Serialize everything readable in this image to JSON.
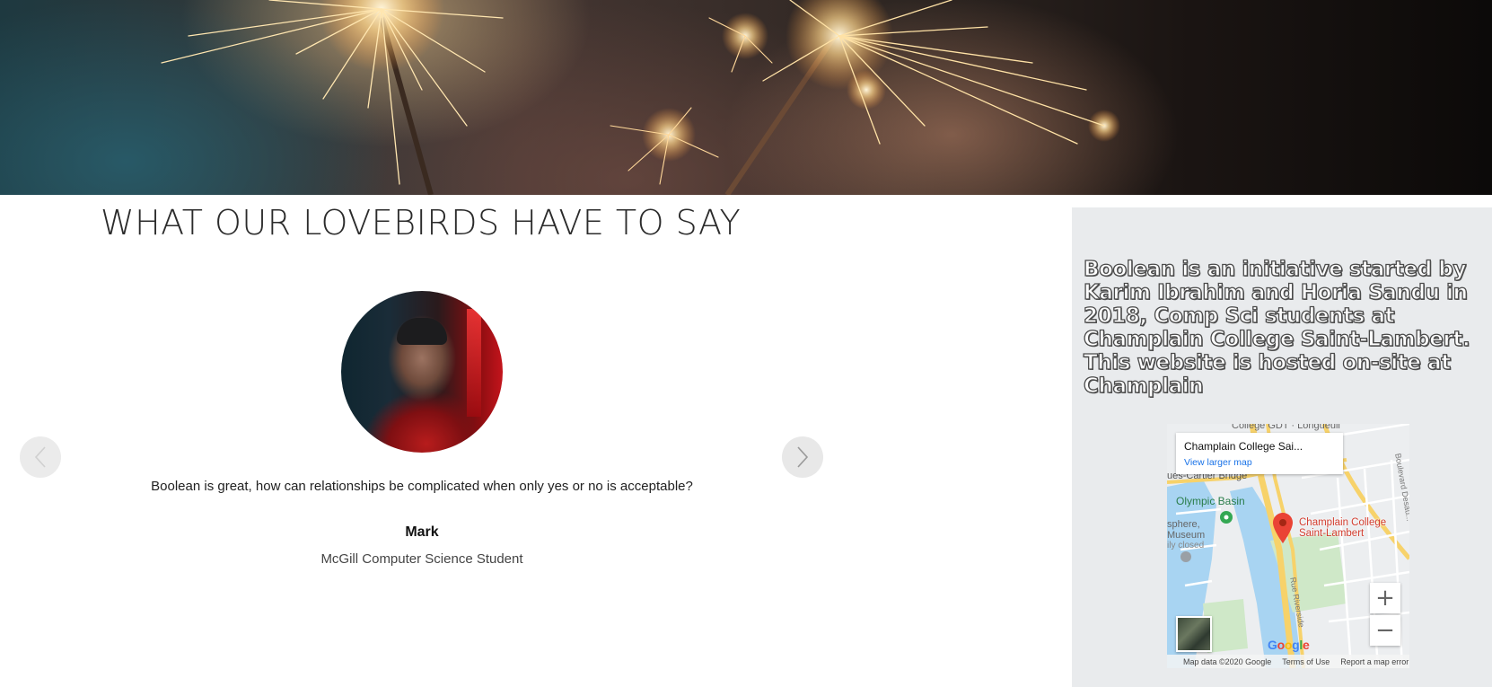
{
  "testimonials": {
    "heading": "WHAT OUR LOVEBIRDS HAVE TO SAY",
    "quote": "Boolean is great, how can relationships be complicated when only yes or no is acceptable?",
    "author_name": "Mark",
    "author_title": "McGill Computer Science Student"
  },
  "about": {
    "text": "Boolean is an initiative started by Karim Ibrahim and Horia Sandu in 2018, Comp Sci students at Champlain College Saint-Lambert. This website is hosted on-site at Champlain"
  },
  "map": {
    "place_name": "Champlain College Sai...",
    "larger_map_link": "View larger map",
    "pin_label_line1": "Champlain College",
    "pin_label_line2": "Saint-Lambert",
    "labels": {
      "top": "College GDT · Longueuil",
      "bridge": "ues-Cartier Bridge",
      "basin": "Olympic Basin",
      "museum_1": "sphere,",
      "museum_2": "Museum",
      "museum_3": "ily closed",
      "riverside": "Rue Riverside",
      "boulevard": "Boulevard Desau..."
    },
    "zoom_in": "+",
    "zoom_out": "−",
    "google_letters": [
      "G",
      "o",
      "o",
      "g",
      "l",
      "e"
    ],
    "footer": {
      "data": "Map data ©2020 Google",
      "terms": "Terms of Use",
      "report": "Report a map error"
    }
  },
  "colors": {
    "panel_bg": "#e9ebed",
    "link_blue": "#1a73e8",
    "pin_red": "#d23c2e"
  }
}
